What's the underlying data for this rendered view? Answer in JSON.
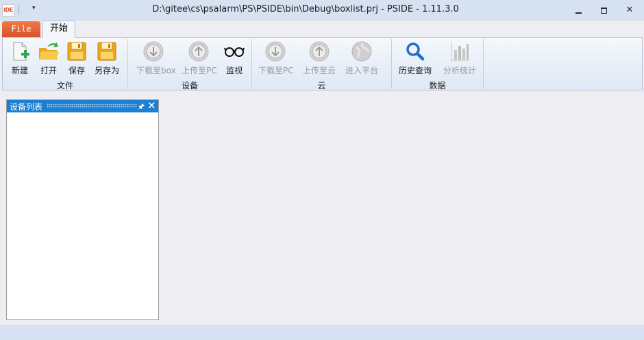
{
  "app": {
    "icon_text": "IDE",
    "title": "D:\\gitee\\cs\\psalarm\\PS\\PSIDE\\bin\\Debug\\boxlist.prj - PSIDE - 1.11.3.0",
    "qat_arrow": "▾",
    "close_glyph": "✕"
  },
  "tabs": {
    "file": "File",
    "home": "开始"
  },
  "ribbon": {
    "groups": [
      {
        "label": "文件",
        "buttons": [
          {
            "label": "新建",
            "icon": "new-file-icon",
            "enabled": true
          },
          {
            "label": "打开",
            "icon": "open-folder-icon",
            "enabled": true
          },
          {
            "label": "保存",
            "icon": "save-icon",
            "enabled": true
          },
          {
            "label": "另存为",
            "icon": "save-as-icon",
            "enabled": true
          }
        ]
      },
      {
        "label": "设备",
        "buttons": [
          {
            "label": "下载至box",
            "icon": "download-icon",
            "enabled": false
          },
          {
            "label": "上传至PC",
            "icon": "upload-icon",
            "enabled": false
          },
          {
            "label": "监视",
            "icon": "glasses-icon",
            "enabled": true
          }
        ]
      },
      {
        "label": "云",
        "buttons": [
          {
            "label": "下载至PC",
            "icon": "download-icon",
            "enabled": false
          },
          {
            "label": "上传至云",
            "icon": "upload-icon",
            "enabled": false
          },
          {
            "label": "进入平台",
            "icon": "globe-icon",
            "enabled": false
          }
        ]
      },
      {
        "label": "数据",
        "buttons": [
          {
            "label": "历史查询",
            "icon": "search-icon",
            "enabled": true
          },
          {
            "label": "分析统计",
            "icon": "bar-chart-icon",
            "enabled": false
          }
        ]
      }
    ]
  },
  "panel": {
    "title": "设备列表",
    "pin_glyph": "🖈",
    "close_glyph": "✕"
  },
  "colors": {
    "file_tab": "#d9532a",
    "panel_header": "#1c7fd2",
    "titlebar": "#d6e1f1"
  }
}
